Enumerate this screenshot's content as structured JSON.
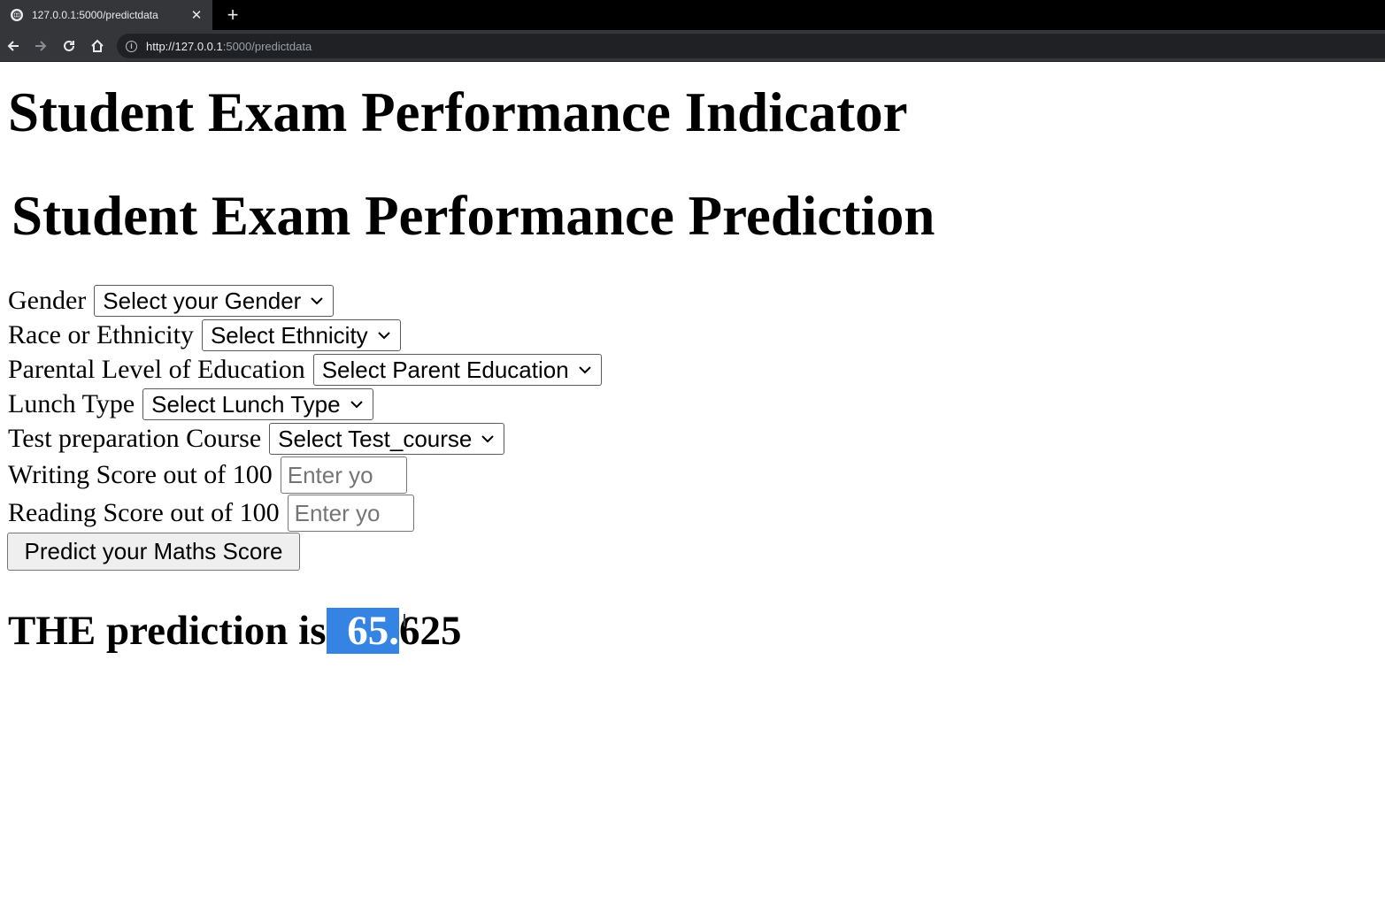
{
  "browser": {
    "tab_title": "127.0.0.1:5000/predictdata",
    "tab_close": "✕",
    "new_tab": "+",
    "url_host": "http://127.0.0.1",
    "url_rest": ":5000/predictdata"
  },
  "page": {
    "heading": "Student Exam Performance Indicator",
    "subheading": "Student Exam Performance Prediction"
  },
  "form": {
    "gender": {
      "label": "Gender",
      "selected": "Select your Gender"
    },
    "ethnicity": {
      "label": "Race or Ethnicity",
      "selected": "Select Ethnicity"
    },
    "parental_education": {
      "label": "Parental Level of Education",
      "selected": "Select Parent Education"
    },
    "lunch": {
      "label": "Lunch Type",
      "selected": "Select Lunch Type"
    },
    "test_prep": {
      "label": "Test preparation Course",
      "selected": "Select Test_course"
    },
    "writing": {
      "label": "Writing Score out of 100",
      "placeholder": "Enter yo"
    },
    "reading": {
      "label": "Reading Score out of 100",
      "placeholder": "Enter yo"
    },
    "submit_label": "Predict your Maths Score"
  },
  "result": {
    "prefix": "THE prediction is",
    "highlighted": " 65.",
    "rest": "625"
  }
}
